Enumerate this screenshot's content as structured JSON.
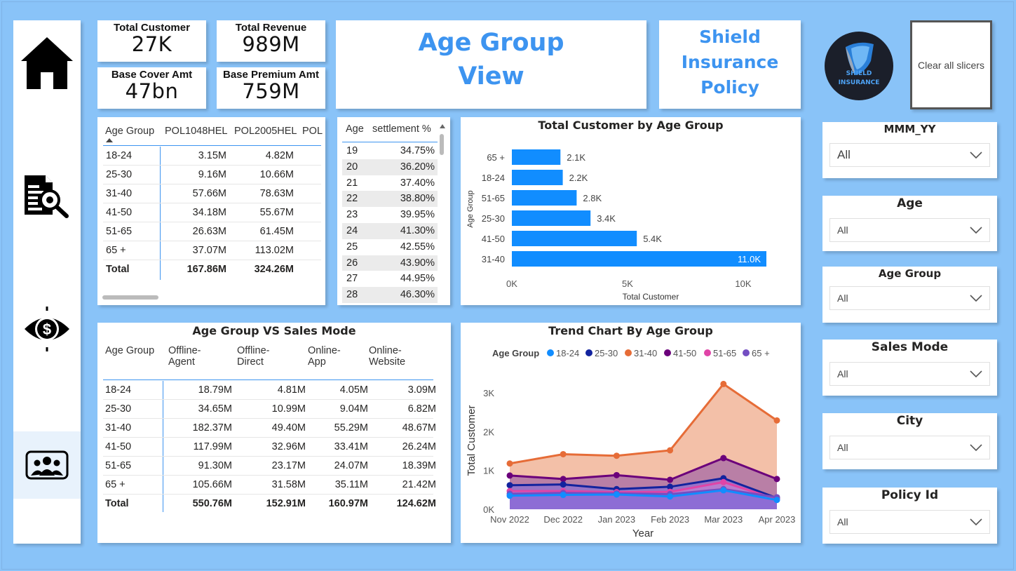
{
  "kpis": {
    "total_customer": {
      "label": "Total Customer",
      "value": "27K"
    },
    "total_revenue": {
      "label": "Total Revenue",
      "value": "989M"
    },
    "base_cover": {
      "label": "Base Cover Amt",
      "value": "47bn"
    },
    "base_premium": {
      "label": "Base Premium Amt",
      "value": "759M"
    }
  },
  "page_title": {
    "line1": "Age Group",
    "line2": "View"
  },
  "brand_title": {
    "line1": "Shield",
    "line2": "Insurance",
    "line3": "Policy"
  },
  "logo": {
    "line1": "SHIELD",
    "line2": "INSURANCE"
  },
  "clear_slicers_label": "Clear all slicers",
  "nav": {
    "home_icon": "home-icon",
    "report_icon": "document-search-icon",
    "revenue_icon": "dollar-eye-icon",
    "age_group_icon": "group-icon"
  },
  "policy_table": {
    "headers": [
      "Age Group",
      "POL1048HEL",
      "POL2005HEL",
      "POL"
    ],
    "rows": [
      [
        "18-24",
        "3.15M",
        "4.82M"
      ],
      [
        "25-30",
        "9.16M",
        "10.66M"
      ],
      [
        "31-40",
        "57.66M",
        "78.63M"
      ],
      [
        "41-50",
        "34.18M",
        "55.67M"
      ],
      [
        "51-65",
        "26.63M",
        "61.45M"
      ],
      [
        "65 +",
        "37.07M",
        "113.02M"
      ]
    ],
    "total": [
      "Total",
      "167.86M",
      "324.26M"
    ]
  },
  "settlement_table": {
    "headers": [
      "Age",
      "settlement %"
    ],
    "rows": [
      [
        "19",
        "34.75%"
      ],
      [
        "20",
        "36.20%"
      ],
      [
        "21",
        "37.40%"
      ],
      [
        "22",
        "38.80%"
      ],
      [
        "23",
        "39.95%"
      ],
      [
        "24",
        "41.30%"
      ],
      [
        "25",
        "42.55%"
      ],
      [
        "26",
        "43.90%"
      ],
      [
        "27",
        "44.95%"
      ],
      [
        "28",
        "46.30%"
      ]
    ]
  },
  "sales_table": {
    "title": "Age Group VS Sales Mode",
    "headers": [
      {
        "l1": "Age Group",
        "l2": ""
      },
      {
        "l1": "Offline-",
        "l2": "Agent"
      },
      {
        "l1": "Offline-",
        "l2": "Direct"
      },
      {
        "l1": "Online-",
        "l2": "App"
      },
      {
        "l1": "Online-",
        "l2": "Website"
      }
    ],
    "rows": [
      [
        "18-24",
        "18.79M",
        "4.81M",
        "4.05M",
        "3.09M"
      ],
      [
        "25-30",
        "34.65M",
        "10.99M",
        "9.04M",
        "6.82M"
      ],
      [
        "31-40",
        "182.37M",
        "49.40M",
        "55.29M",
        "48.67M"
      ],
      [
        "41-50",
        "117.99M",
        "32.96M",
        "33.41M",
        "26.24M"
      ],
      [
        "51-65",
        "91.30M",
        "23.17M",
        "24.07M",
        "18.39M"
      ],
      [
        "65 +",
        "105.66M",
        "31.58M",
        "35.11M",
        "21.42M"
      ]
    ],
    "total": [
      "Total",
      "550.76M",
      "152.91M",
      "160.97M",
      "124.62M"
    ]
  },
  "slicers": [
    {
      "title": "MMM_YY",
      "value": "All"
    },
    {
      "title": "Age",
      "value": "All"
    },
    {
      "title": "Age Group",
      "value": "All"
    },
    {
      "title": "Sales Mode",
      "value": "All"
    },
    {
      "title": "City",
      "value": "All"
    },
    {
      "title": "Policy Id",
      "value": "All"
    }
  ],
  "colors": {
    "accent": "#3d94f0",
    "bar": "#118dff",
    "background": "#89c3f8"
  },
  "chart_data": [
    {
      "type": "bar",
      "orientation": "horizontal",
      "title": "Total Customer by Age Group",
      "xlabel": "Total Customer",
      "ylabel": "Age Group",
      "categories": [
        "65 +",
        "18-24",
        "51-65",
        "25-30",
        "41-50",
        "31-40"
      ],
      "values": [
        2100,
        2200,
        2800,
        3400,
        5400,
        11000
      ],
      "data_labels": [
        "2.1K",
        "2.2K",
        "2.8K",
        "3.4K",
        "5.4K",
        "11.0K"
      ],
      "xticks": [
        "0K",
        "5K",
        "10K"
      ],
      "xlim": [
        0,
        11000
      ],
      "color": "#118dff"
    },
    {
      "type": "area",
      "title": "Trend Chart By Age Group",
      "xlabel": "Year",
      "ylabel": "Total Customer",
      "legend_title": "Age Group",
      "legend_position": "top",
      "x": [
        "Nov 2022",
        "Dec 2022",
        "Jan 2023",
        "Feb 2023",
        "Mar 2023",
        "Apr 2023"
      ],
      "yticks": [
        "0K",
        "1K",
        "2K",
        "3K"
      ],
      "ylim": [
        0,
        3400
      ],
      "series": [
        {
          "name": "31-40",
          "color": "#e66c37",
          "fill": "#f3c0a8",
          "values": [
            1180,
            1420,
            1380,
            1520,
            3230,
            2290
          ]
        },
        {
          "name": "41-50",
          "color": "#6b007b",
          "fill": "#a56aa5",
          "values": [
            870,
            780,
            880,
            760,
            1320,
            780
          ]
        },
        {
          "name": "25-30",
          "color": "#12239e",
          "fill": "#8d6fd0",
          "values": [
            620,
            640,
            520,
            580,
            800,
            290
          ]
        },
        {
          "name": "51-65",
          "color": "#e044a7",
          "fill": "#c37ed0",
          "values": [
            470,
            470,
            440,
            450,
            700,
            260
          ]
        },
        {
          "name": "65 +",
          "color": "#744ec2",
          "fill": "#8d5fc8",
          "values": [
            400,
            420,
            410,
            390,
            520,
            310
          ]
        },
        {
          "name": "18-24",
          "color": "#118dff",
          "fill": "#8a70d8",
          "values": [
            350,
            370,
            380,
            330,
            490,
            240
          ]
        }
      ],
      "legend_order": [
        "18-24",
        "25-30",
        "31-40",
        "41-50",
        "51-65",
        "65 +"
      ]
    }
  ]
}
